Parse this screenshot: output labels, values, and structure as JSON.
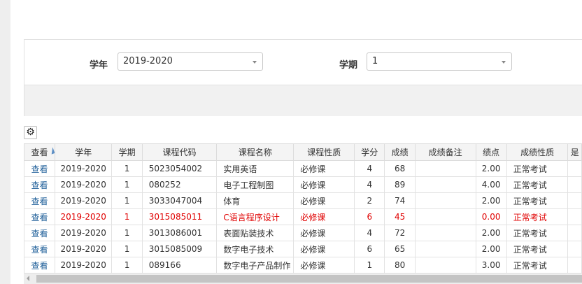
{
  "filters": {
    "year_label": "学年",
    "year_value": "2019-2020",
    "term_label": "学期",
    "term_value": "1"
  },
  "table": {
    "columns": [
      "查看",
      "学年",
      "学期",
      "课程代码",
      "课程名称",
      "课程性质",
      "学分",
      "成绩",
      "成绩备注",
      "绩点",
      "成绩性质",
      "是"
    ],
    "rows": [
      [
        "查看",
        "2019-2020",
        "1",
        "5023054002",
        "实用英语",
        "必修课",
        "4",
        "68",
        "",
        "2.00",
        "正常考试"
      ],
      [
        "查看",
        "2019-2020",
        "1",
        "080252",
        "电子工程制图",
        "必修课",
        "4",
        "89",
        "",
        "4.00",
        "正常考试"
      ],
      [
        "查看",
        "2019-2020",
        "1",
        "3033047004",
        "体育",
        "必修课",
        "2",
        "74",
        "",
        "2.00",
        "正常考试"
      ],
      [
        "查看",
        "2019-2020",
        "1",
        "3015085011",
        "C语言程序设计",
        "必修课",
        "6",
        "45",
        "",
        "0.00",
        "正常考试"
      ],
      [
        "查看",
        "2019-2020",
        "1",
        "3013086001",
        "表面贴装技术",
        "必修课",
        "4",
        "72",
        "",
        "2.00",
        "正常考试"
      ],
      [
        "查看",
        "2019-2020",
        "1",
        "3015085009",
        "数字电子技术",
        "必修课",
        "6",
        "65",
        "",
        "2.00",
        "正常考试"
      ],
      [
        "查看",
        "2019-2020",
        "1",
        "089166",
        "数字电子产品制作",
        "必修课",
        "1",
        "80",
        "",
        "3.00",
        "正常考试"
      ]
    ],
    "failed_row_index": 3,
    "failed_color": "#e00000",
    "link_color": "#1f5f99"
  },
  "icons": {
    "settings": "gear-icon",
    "sort": "sort-icon",
    "dropdown": "chevron-down-icon",
    "scroll_left": "arrow-left-icon"
  }
}
